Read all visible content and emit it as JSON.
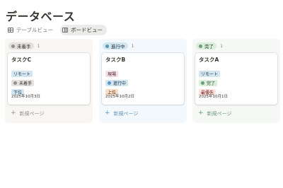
{
  "title": "データベース",
  "views": [
    {
      "label": "テーブルビュー",
      "icon": "table-icon",
      "active": false
    },
    {
      "label": "ボードビュー",
      "icon": "board-icon",
      "active": true
    }
  ],
  "columns": [
    {
      "status": "未着手",
      "count": "1",
      "pill_bg": "#e3e2e0",
      "pill_color": "#32302c",
      "dot": "#91918e",
      "card": {
        "title": "タスクC",
        "category": "リモート",
        "category_bg": "#d3e5ef",
        "category_color": "#183347",
        "status": "未着手",
        "status_bg": "#e3e2e0",
        "status_color": "#32302c",
        "status_dot": "#91918e",
        "priority": "下位",
        "priority_bg": "#d3e5ef",
        "priority_color": "#183347",
        "date": "2025年10月3日"
      },
      "new_page": "新規ページ",
      "new_color": "#91918e"
    },
    {
      "status": "進行中",
      "count": "1",
      "pill_bg": "#d3e5ef",
      "pill_color": "#183347",
      "dot": "#5b97bd",
      "card": {
        "title": "タスクB",
        "category": "現場",
        "category_bg": "#f5e0e9",
        "category_color": "#4c2337",
        "status": "進行中",
        "status_bg": "#d3e5ef",
        "status_color": "#183347",
        "status_dot": "#5b97bd",
        "priority": "上位",
        "priority_bg": "#fadec9",
        "priority_color": "#49290e",
        "date": "2025年10月2日"
      },
      "new_page": "新規ページ",
      "new_color": "#5b97bd"
    },
    {
      "status": "完了",
      "count": "1",
      "pill_bg": "#dbeddb",
      "pill_color": "#1c3829",
      "dot": "#6c9b7d",
      "card": {
        "title": "タスクA",
        "category": "リモート",
        "category_bg": "#d3e5ef",
        "category_color": "#183347",
        "status": "完了",
        "status_bg": "#dbeddb",
        "status_color": "#1c3829",
        "status_dot": "#6c9b7d",
        "priority": "最優先",
        "priority_bg": "#ffe2dd",
        "priority_color": "#5d1715",
        "date": "2025年10月1日"
      },
      "new_page": "新規ページ",
      "new_color": "#6c9b7d"
    }
  ]
}
